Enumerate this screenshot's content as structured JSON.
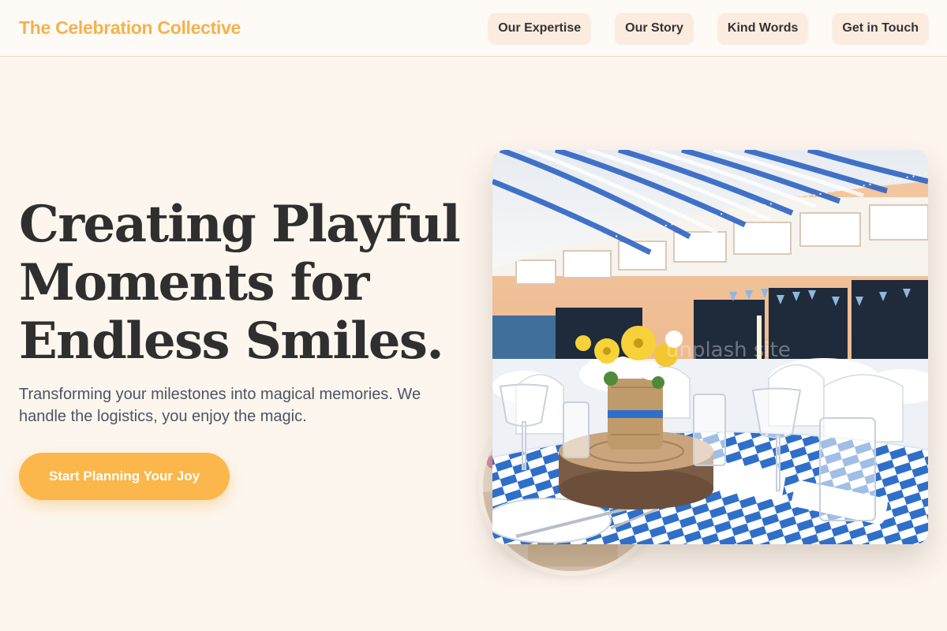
{
  "brand": {
    "name": "The Celebration Collective"
  },
  "nav": {
    "items": [
      {
        "label": "Our Expertise"
      },
      {
        "label": "Our Story"
      },
      {
        "label": "Kind Words"
      },
      {
        "label": "Get in Touch"
      }
    ]
  },
  "hero": {
    "title_line1": "Creating Playful",
    "title_line2": "Moments for",
    "title_line3": "Endless Smiles.",
    "subtitle": "Transforming your milestones into magical memories. We handle the logistics, you enjoy the magic.",
    "cta_label": "Start Planning Your Joy"
  },
  "colors": {
    "accent": "#f5b24c",
    "button": "#fbb74b",
    "background": "#fdf6ee",
    "nav_pill": "#fcebdf",
    "heading": "#2f2f2f"
  },
  "icons": {
    "hero_image": "banquet-hall-photo",
    "decor_image": "decor-circle-photo"
  }
}
